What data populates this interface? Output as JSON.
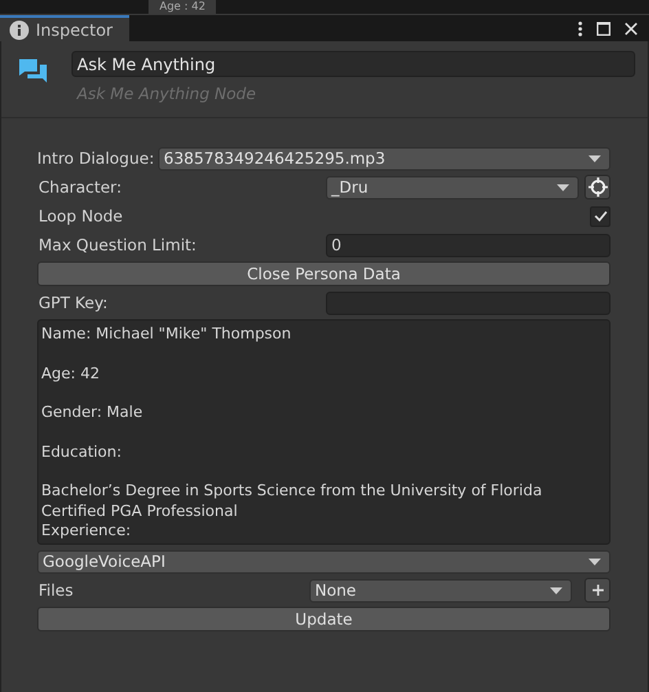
{
  "background_text": "Age : 42",
  "tabs": [
    {
      "label": "Inspector",
      "selected": true
    }
  ],
  "node": {
    "name": "Ask Me Anything",
    "subtitle": "Ask Me Anything Node"
  },
  "fields": [
    {
      "kind": "dropdown",
      "label": "Intro Dialogue:",
      "value": "638578349246425295.mp3"
    },
    {
      "kind": "object",
      "label": "Character:",
      "value": "_Dru"
    },
    {
      "kind": "toggle",
      "label": "Loop Node",
      "checked": true
    },
    {
      "kind": "number",
      "label": "Max Question Limit:",
      "value": "0"
    },
    {
      "kind": "button",
      "label": "Close Persona Data"
    },
    {
      "kind": "number",
      "label": "GPT Key:"
    },
    {
      "kind": "textarea",
      "value": "Name: Michael \"Mike\" Thompson\n\nAge: 42\n\nGender: Male\n\nEducation:\n\nBachelor’s Degree in Sports Science from the University of Florida\nCertified PGA Professional\nExperience:"
    },
    {
      "kind": "dropdown",
      "value": "GoogleVoiceAPI"
    },
    {
      "kind": "files",
      "label": "Files",
      "value": "None"
    },
    {
      "kind": "button",
      "label": "Update"
    }
  ]
}
